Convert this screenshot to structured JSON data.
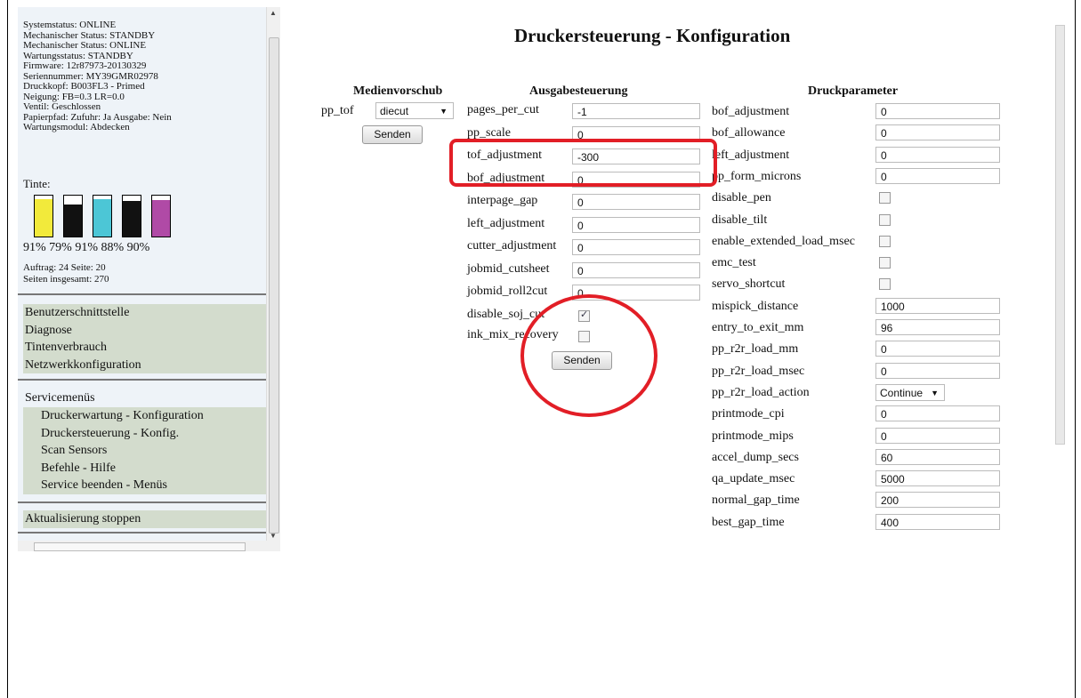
{
  "status": {
    "lines": [
      "Systemstatus: ONLINE",
      "Mechanischer Status: STANDBY",
      "Mechanischer Status: ONLINE",
      "Wartungsstatus: STANDBY",
      "Firmware: 12r87973-20130329",
      "Seriennummer: MY39GMR02978",
      "Druckkopf: B003FL3 - Primed",
      "Neigung: FB=0.3 LR=0.0",
      "Ventil: Geschlossen",
      "Papierpfad: Zufuhr: Ja Ausgabe: Nein",
      "Wartungsmodul: Abdecken"
    ]
  },
  "ink": {
    "title": "Tinte:",
    "levels": [
      {
        "level": 0.91,
        "color": "#f2ea3b"
      },
      {
        "level": 0.79,
        "color": "#111111"
      },
      {
        "level": 0.91,
        "color": "#4cc6d6"
      },
      {
        "level": 0.88,
        "color": "#111111"
      },
      {
        "level": 0.9,
        "color": "#b04aa6"
      }
    ],
    "percent_text": "91% 79% 91% 88% 90%"
  },
  "job": {
    "line1": "Auftrag: 24 Seite: 20",
    "line2": "Seiten insgesamt: 270"
  },
  "menu1": [
    "Benutzerschnittstelle",
    "Diagnose",
    "Tintenverbrauch",
    "Netzwerkkonfiguration"
  ],
  "menu2": {
    "title": "Servicemenüs",
    "items": [
      "Druckerwartung - Konfiguration",
      "Druckersteuerung - Konfig.",
      "Scan Sensors",
      "Befehle - Hilfe",
      "Service beenden - Menüs"
    ]
  },
  "stop": "Aktualisierung stoppen",
  "page_title": "Druckersteuerung - Konfiguration",
  "media": {
    "head": "Medienvorschub",
    "label": "pp_tof",
    "select_value": "diecut",
    "button": "Senden"
  },
  "output": {
    "head": "Ausgabesteuerung",
    "fields": [
      {
        "label": "pages_per_cut",
        "value": "-1"
      },
      {
        "label": "pp_scale",
        "value": "0"
      },
      {
        "label": "tof_adjustment",
        "value": "-300"
      },
      {
        "label": "bof_adjustment",
        "value": "0"
      },
      {
        "label": "interpage_gap",
        "value": "0"
      },
      {
        "label": "left_adjustment",
        "value": "0"
      },
      {
        "label": "cutter_adjustment",
        "value": "0"
      },
      {
        "label": "jobmid_cutsheet",
        "value": "0"
      },
      {
        "label": "jobmid_roll2cut",
        "value": "0"
      }
    ],
    "checks": [
      {
        "label": "disable_soj_cut",
        "checked": true
      },
      {
        "label": "ink_mix_recovery",
        "checked": false
      }
    ],
    "button": "Senden"
  },
  "params": {
    "head": "Druckparameter",
    "rows": [
      {
        "label": "bof_adjustment",
        "type": "text",
        "value": "0"
      },
      {
        "label": "bof_allowance",
        "type": "text",
        "value": "0"
      },
      {
        "label": "left_adjustment",
        "type": "text",
        "value": "0"
      },
      {
        "label": "pp_form_microns",
        "type": "text",
        "value": "0"
      },
      {
        "label": "disable_pen",
        "type": "check",
        "checked": false
      },
      {
        "label": "disable_tilt",
        "type": "check",
        "checked": false
      },
      {
        "label": "enable_extended_load_msec",
        "type": "check",
        "checked": false
      },
      {
        "label": "emc_test",
        "type": "check",
        "checked": false
      },
      {
        "label": "servo_shortcut",
        "type": "check",
        "checked": false
      },
      {
        "label": "mispick_distance",
        "type": "text",
        "value": "1000"
      },
      {
        "label": "entry_to_exit_mm",
        "type": "text",
        "value": "96"
      },
      {
        "label": "pp_r2r_load_mm",
        "type": "text",
        "value": "0"
      },
      {
        "label": "pp_r2r_load_msec",
        "type": "text",
        "value": "0"
      },
      {
        "label": "pp_r2r_load_action",
        "type": "select",
        "value": "Continue"
      },
      {
        "label": "printmode_cpi",
        "type": "text",
        "value": "0"
      },
      {
        "label": "printmode_mips",
        "type": "text",
        "value": "0"
      },
      {
        "label": "accel_dump_secs",
        "type": "text",
        "value": "60"
      },
      {
        "label": "qa_update_msec",
        "type": "text",
        "value": "5000"
      },
      {
        "label": "normal_gap_time",
        "type": "text",
        "value": "200"
      },
      {
        "label": "best_gap_time",
        "type": "text",
        "value": "400"
      }
    ]
  },
  "annotation_color": "#e21e26"
}
